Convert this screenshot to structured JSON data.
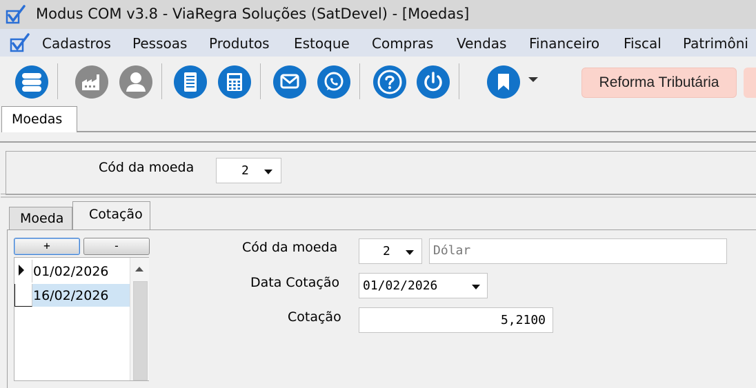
{
  "window": {
    "title": "Modus COM v3.8 - ViaRegra Soluções (SatDevel) - [Moedas]"
  },
  "menu": {
    "items": [
      "Cadastros",
      "Pessoas",
      "Produtos",
      "Estoque",
      "Compras",
      "Vendas",
      "Financeiro",
      "Fiscal",
      "Patrimôni"
    ]
  },
  "toolbar": {
    "buttons": [
      {
        "icon": "database-icon",
        "color": "#1273c9"
      },
      {
        "icon": "factory-icon",
        "color": "#8a8a8a"
      },
      {
        "icon": "user-icon",
        "color": "#8a8a8a"
      },
      {
        "icon": "document-icon",
        "color": "#1273c9"
      },
      {
        "icon": "calculator-icon",
        "color": "#1273c9"
      },
      {
        "icon": "mail-icon",
        "color": "#1273c9"
      },
      {
        "icon": "whatsapp-icon",
        "color": "#1273c9"
      },
      {
        "icon": "help-icon",
        "color": "#1273c9"
      },
      {
        "icon": "power-icon",
        "color": "#1273c9"
      },
      {
        "icon": "bookmark-icon",
        "color": "#1273c9"
      }
    ],
    "reforma_label": "Reforma Tributária",
    "reforma_color": "#fbd4cc"
  },
  "doc_tab": {
    "label": "Moedas"
  },
  "header": {
    "cod_label": "Cód da moeda",
    "cod_value": "2"
  },
  "tabs": {
    "moeda": "Moeda",
    "cotacao": "Cotação",
    "active": "Cotação"
  },
  "list_buttons": {
    "add": "+",
    "remove": "-"
  },
  "list": {
    "rows": [
      "01/02/2026",
      "16/02/2026"
    ],
    "selected_color": "#cfe4f5"
  },
  "form": {
    "cod_label": "Cód da moeda",
    "cod_value": "2",
    "descricao": "Dólar",
    "data_label": "Data Cotação",
    "data_value": "01/02/2026",
    "cotacao_label": "Cotação",
    "cotacao_value": "5,2100"
  }
}
